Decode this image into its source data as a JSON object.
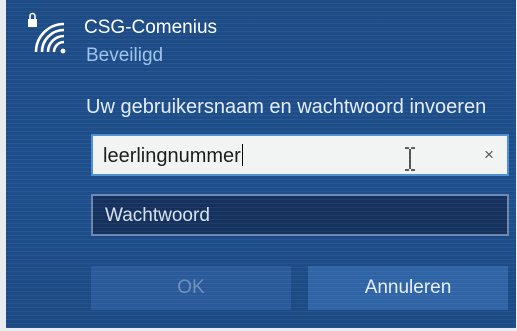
{
  "network": {
    "name": "CSG-Comenius",
    "status": "Beveiligd",
    "icon": "wifi-secured-icon"
  },
  "prompt": "Uw gebruikersnaam en wachtwoord invoeren",
  "username": {
    "value": "leerlingnummer",
    "clear_icon": "×"
  },
  "password": {
    "placeholder": "Wachtwoord"
  },
  "buttons": {
    "ok": "OK",
    "cancel": "Annuleren"
  },
  "colors": {
    "background": "#1e4f8c",
    "accent": "#4d8fd3",
    "status_text": "#9ec3ea"
  }
}
